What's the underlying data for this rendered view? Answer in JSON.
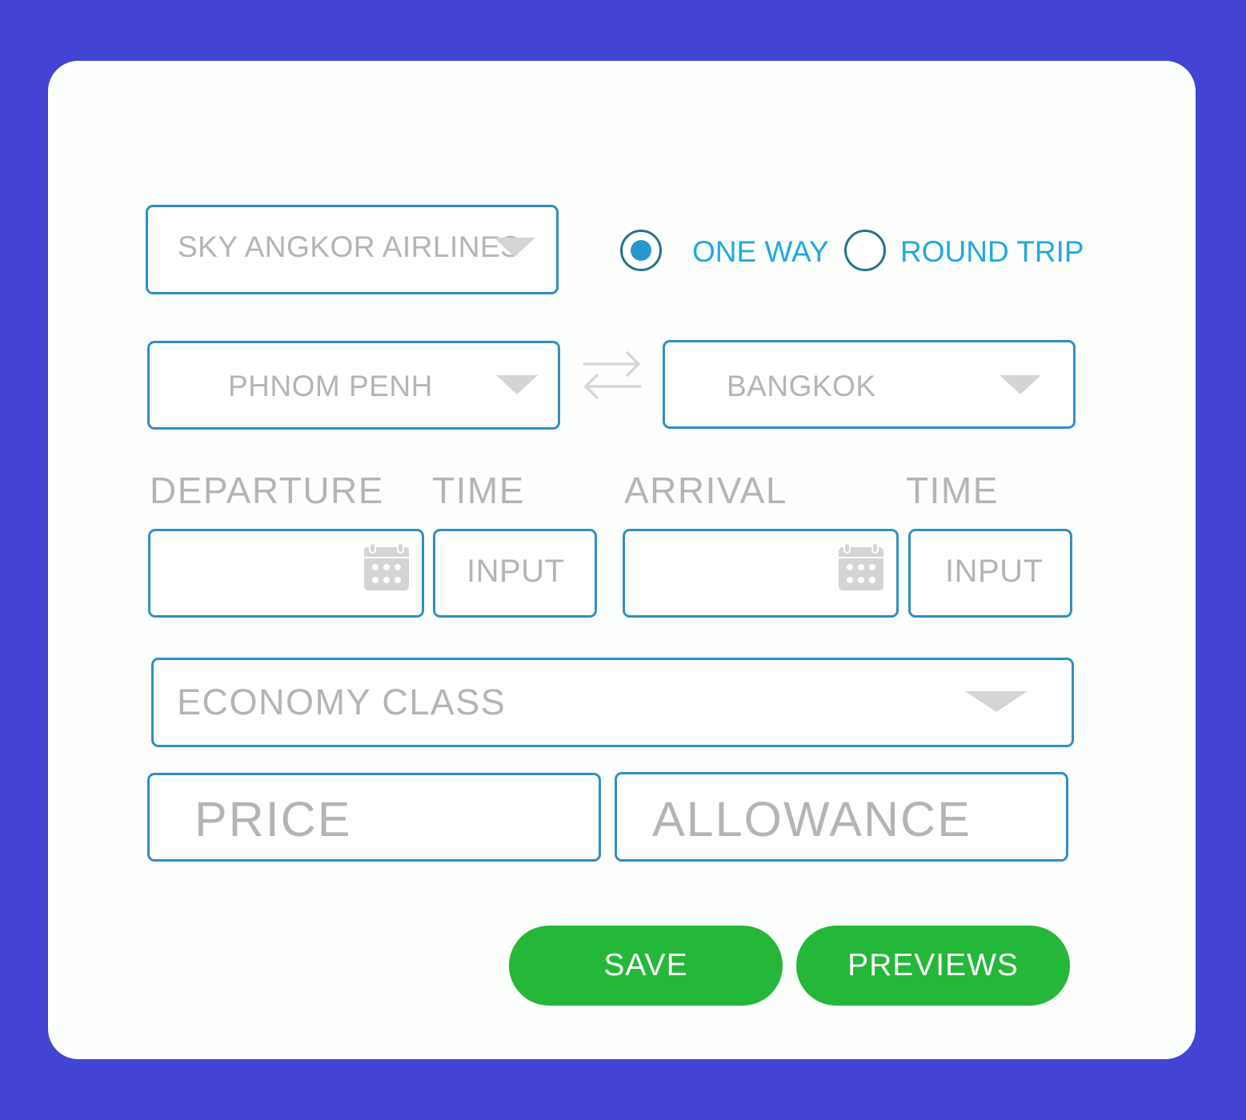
{
  "airline": {
    "value": "SKY ANGKOR AIRLINES"
  },
  "trip_type": {
    "selected": "one_way",
    "one_way_label": "ONE WAY",
    "round_trip_label": "ROUND TRIP"
  },
  "route": {
    "from": "PHNOM PENH",
    "to": "BANGKOK"
  },
  "labels": {
    "departure": "DEPARTURE",
    "departure_time": "TIME",
    "arrival": "ARRIVAL",
    "arrival_time": "TIME"
  },
  "departure": {
    "date_value": "",
    "time_value": "INPUT"
  },
  "arrival": {
    "date_value": "",
    "time_value": "INPUT"
  },
  "seat_class": {
    "value": "ECONOMY CLASS"
  },
  "price": {
    "value": "PRICE"
  },
  "allowance": {
    "value": "ALLOWANCE"
  },
  "buttons": {
    "save": "SAVE",
    "previews": "PREVIEWS"
  },
  "colors": {
    "background": "#4343d4",
    "card": "#fdfffd",
    "field_border": "#2f8fc4",
    "radio_label": "#21a8e0",
    "button": "#24b73a"
  }
}
